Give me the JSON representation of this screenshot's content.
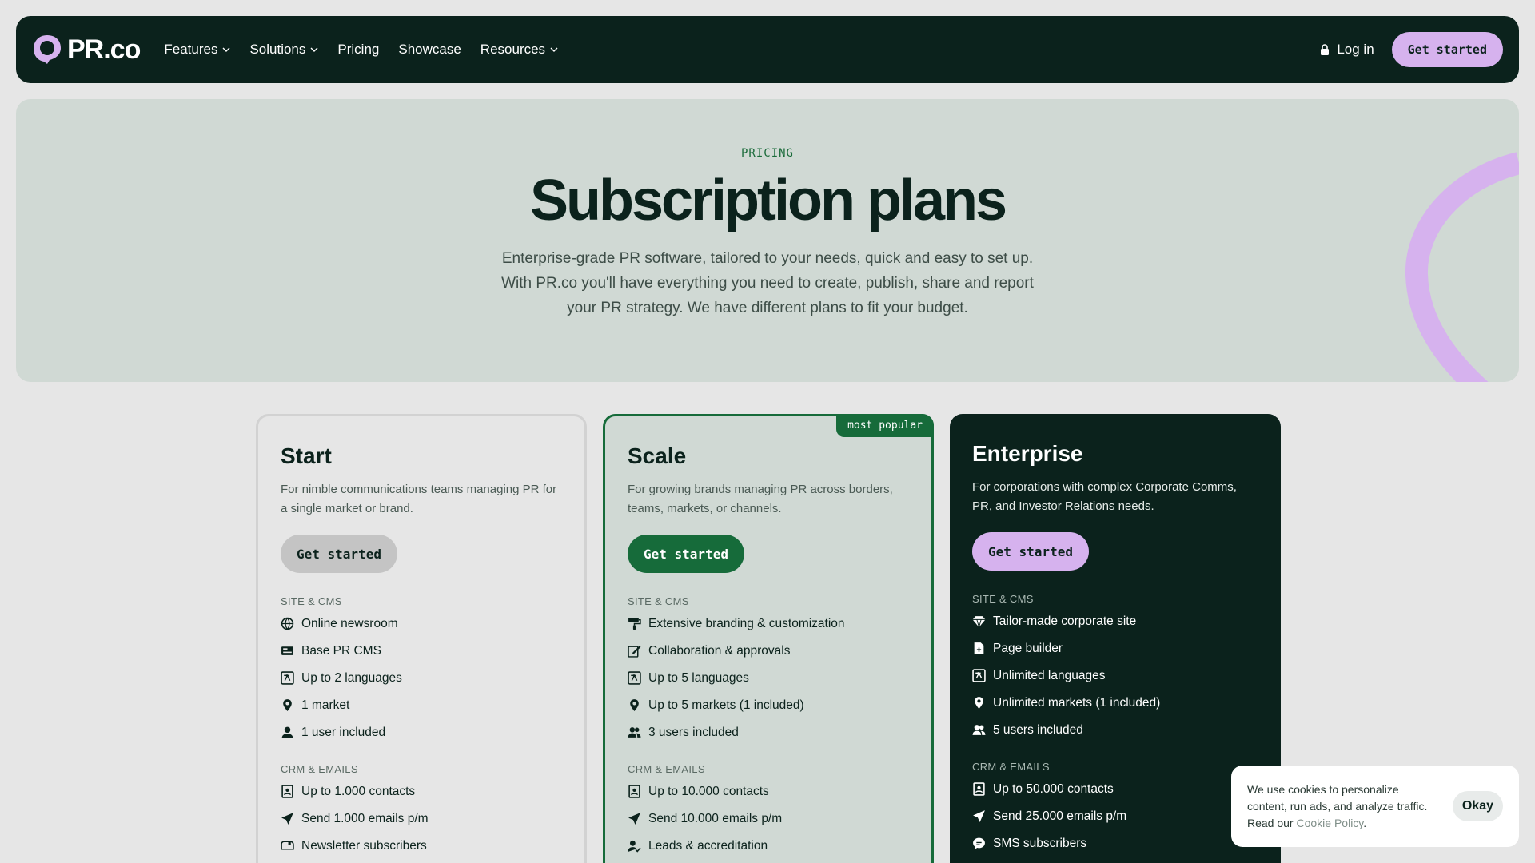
{
  "nav": {
    "logo_text": "PR.co",
    "links": [
      {
        "label": "Features",
        "dropdown": true
      },
      {
        "label": "Solutions",
        "dropdown": true
      },
      {
        "label": "Pricing",
        "dropdown": false
      },
      {
        "label": "Showcase",
        "dropdown": false
      },
      {
        "label": "Resources",
        "dropdown": true
      }
    ],
    "login_label": "Log in",
    "cta_label": "Get started"
  },
  "hero": {
    "eyebrow": "PRICING",
    "title": "Subscription plans",
    "description": "Enterprise-grade PR software, tailored to your needs, quick and easy to set up. With PR.co you'll have everything you need to create, publish, share and report your PR strategy. We have different plans to fit your budget."
  },
  "plans": [
    {
      "name": "Start",
      "description": "For nimble communications teams managing PR for a single market or brand.",
      "button": "Get started",
      "sections": [
        {
          "title": "SITE & CMS",
          "features": [
            {
              "icon": "globe-icon",
              "text": "Online newsroom"
            },
            {
              "icon": "cms-icon",
              "text": "Base PR CMS"
            },
            {
              "icon": "language-icon",
              "text": "Up to 2 languages"
            },
            {
              "icon": "map-pin-icon",
              "text": "1 market"
            },
            {
              "icon": "user-icon",
              "text": "1 user included"
            }
          ]
        },
        {
          "title": "CRM & EMAILS",
          "features": [
            {
              "icon": "contacts-icon",
              "text": "Up to 1.000 contacts"
            },
            {
              "icon": "send-icon",
              "text": "Send 1.000 emails p/m"
            },
            {
              "icon": "mailbox-icon",
              "text": "Newsletter subscribers"
            }
          ]
        }
      ]
    },
    {
      "name": "Scale",
      "badge": "most popular",
      "description": "For growing brands managing PR across borders, teams, markets, or channels.",
      "button": "Get started",
      "sections": [
        {
          "title": "SITE & CMS",
          "features": [
            {
              "icon": "paint-roller-icon",
              "text": "Extensive branding & customization"
            },
            {
              "icon": "edit-icon",
              "text": "Collaboration & approvals"
            },
            {
              "icon": "language-icon",
              "text": "Up to 5 languages"
            },
            {
              "icon": "map-pin-icon",
              "text": "Up to 5 markets (1 included)"
            },
            {
              "icon": "users-icon",
              "text": "3 users included"
            }
          ]
        },
        {
          "title": "CRM & EMAILS",
          "features": [
            {
              "icon": "contacts-icon",
              "text": "Up to 10.000 contacts"
            },
            {
              "icon": "send-icon",
              "text": "Send 10.000 emails p/m"
            },
            {
              "icon": "user-check-icon",
              "text": "Leads & accreditation"
            }
          ]
        }
      ]
    },
    {
      "name": "Enterprise",
      "description": "For corporations with complex Corporate Comms, PR, and Investor Relations needs.",
      "button": "Get started",
      "sections": [
        {
          "title": "SITE & CMS",
          "features": [
            {
              "icon": "diamond-icon",
              "text": "Tailor-made corporate site"
            },
            {
              "icon": "file-plus-icon",
              "text": "Page builder"
            },
            {
              "icon": "language-icon",
              "text": "Unlimited languages"
            },
            {
              "icon": "map-pin-icon",
              "text": "Unlimited markets (1 included)"
            },
            {
              "icon": "users-icon",
              "text": "5 users included"
            }
          ]
        },
        {
          "title": "CRM & EMAILS",
          "features": [
            {
              "icon": "contacts-icon",
              "text": "Up to 50.000 contacts"
            },
            {
              "icon": "send-icon",
              "text": "Send 25.000 emails p/m"
            },
            {
              "icon": "chat-icon",
              "text": "SMS subscribers"
            }
          ]
        }
      ]
    }
  ],
  "cookie": {
    "text": "We use cookies to personalize content, run ads, and analyze traffic. Read our ",
    "link_label": "Cookie Policy",
    "suffix": ".",
    "button": "Okay"
  },
  "colors": {
    "dark": "#0b221c",
    "green": "#166b3a",
    "lilac": "#d6b2ee",
    "hero_bg": "#d0d9d4"
  }
}
